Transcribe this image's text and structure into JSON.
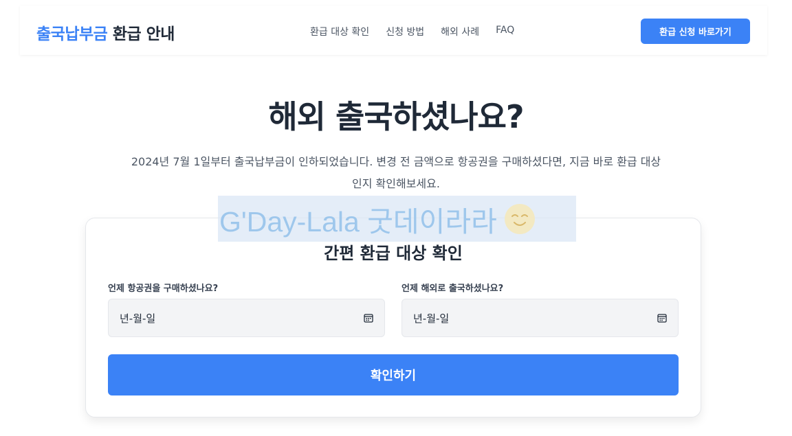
{
  "header": {
    "logo_brand": "출국납부금",
    "logo_rest": " 환급 안내",
    "nav": [
      "환급 대상 확인",
      "신청 방법",
      "해외 사례",
      "FAQ"
    ],
    "cta_label": "환급 신청 바로가기"
  },
  "hero": {
    "title": "해외 출국하셨나요?",
    "description": "2024년 7월 1일부터 출국납부금이 인하되었습니다. 변경 전 금액으로 항공권을 구매하셨다면, 지금 바로 환급 대상인지 확인해보세요."
  },
  "card": {
    "title": "간편 환급 대상 확인",
    "purchase_label": "언제 항공권을 구매하셨나요?",
    "purchase_placeholder": "년-월-일",
    "departure_label": "언제 해외로 출국하셨나요?",
    "departure_placeholder": "년-월-일",
    "submit_label": "확인하기"
  },
  "watermark": {
    "text": "G'Day-Lala 굿데이라라"
  },
  "colors": {
    "accent": "#3b82f6",
    "text": "#1f2937",
    "muted": "#4b5563",
    "input_bg": "#f3f4f6"
  },
  "icons": [
    "calendar-icon",
    "smiley-icon"
  ]
}
